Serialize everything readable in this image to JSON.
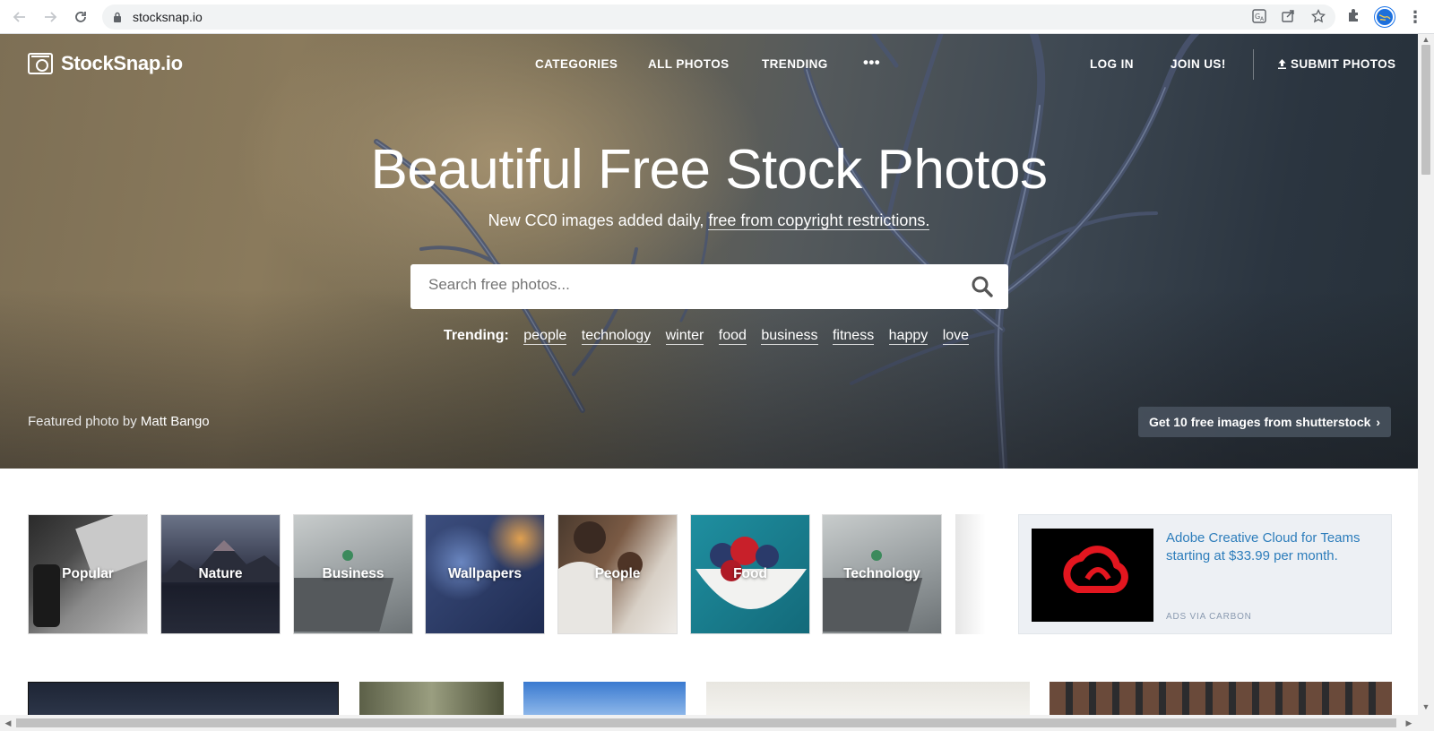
{
  "browser": {
    "url": "stocksnap.io",
    "icons": [
      "back-icon",
      "forward-icon",
      "reload-icon",
      "lock-icon",
      "translate-icon",
      "share-icon",
      "bookmark-star-icon",
      "extensions-icon",
      "profile-avatar",
      "menu-icon"
    ]
  },
  "header": {
    "logo_text": "StockSnap.io",
    "nav": {
      "categories": "CATEGORIES",
      "all_photos": "ALL PHOTOS",
      "trending": "TRENDING",
      "more": "•••",
      "login": "LOG IN",
      "join": "JOIN US!",
      "submit": "SUBMIT PHOTOS"
    }
  },
  "hero": {
    "headline": "Beautiful Free Stock Photos",
    "subline_prefix": "New CC0 images added daily, ",
    "subline_link": "free from copyright restrictions.",
    "search_placeholder": "Search free photos...",
    "trending_label": "Trending:",
    "trending_tags": [
      "people",
      "technology",
      "winter",
      "food",
      "business",
      "fitness",
      "happy",
      "love"
    ],
    "featured_prefix": "Featured photo by ",
    "featured_author": "Matt Bango",
    "promo": "Get 10 free images from shutterstock",
    "promo_chevron": "›"
  },
  "categories": [
    "Popular",
    "Nature",
    "Business",
    "Wallpapers",
    "People",
    "Food",
    "Technology"
  ],
  "ad": {
    "text": "Adobe Creative Cloud for Teams starting at $33.99 per month.",
    "via": "ADS VIA CARBON"
  },
  "colors": {
    "ad_link": "#2d7dbb",
    "adobe_red": "#e3161f",
    "promo_bg": "#46505c"
  }
}
